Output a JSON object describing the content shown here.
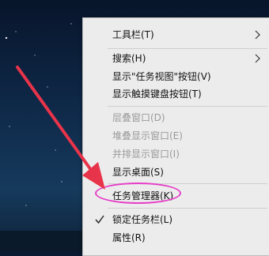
{
  "context_menu": {
    "items": [
      {
        "label": "工具栏(T)",
        "disabled": false,
        "submenu": true
      },
      {
        "label": "搜索(H)",
        "disabled": false,
        "submenu": true
      },
      {
        "label": "显示\"任务视图\"按钮(V)",
        "disabled": false
      },
      {
        "label": "显示触摸键盘按钮(T)",
        "disabled": false
      },
      {
        "label": "层叠窗口(D)",
        "disabled": true
      },
      {
        "label": "堆叠显示窗口(E)",
        "disabled": true
      },
      {
        "label": "并排显示窗口(I)",
        "disabled": true
      },
      {
        "label": "显示桌面(S)",
        "disabled": false
      },
      {
        "label": "任务管理器(K)",
        "disabled": false,
        "highlighted": true
      },
      {
        "label": "锁定任务栏(L)",
        "disabled": false,
        "checked": true
      },
      {
        "label": "属性(R)",
        "disabled": false
      }
    ]
  },
  "annotation": {
    "arrow_color": "#e8344a",
    "highlight_color": "#e63ec8"
  }
}
